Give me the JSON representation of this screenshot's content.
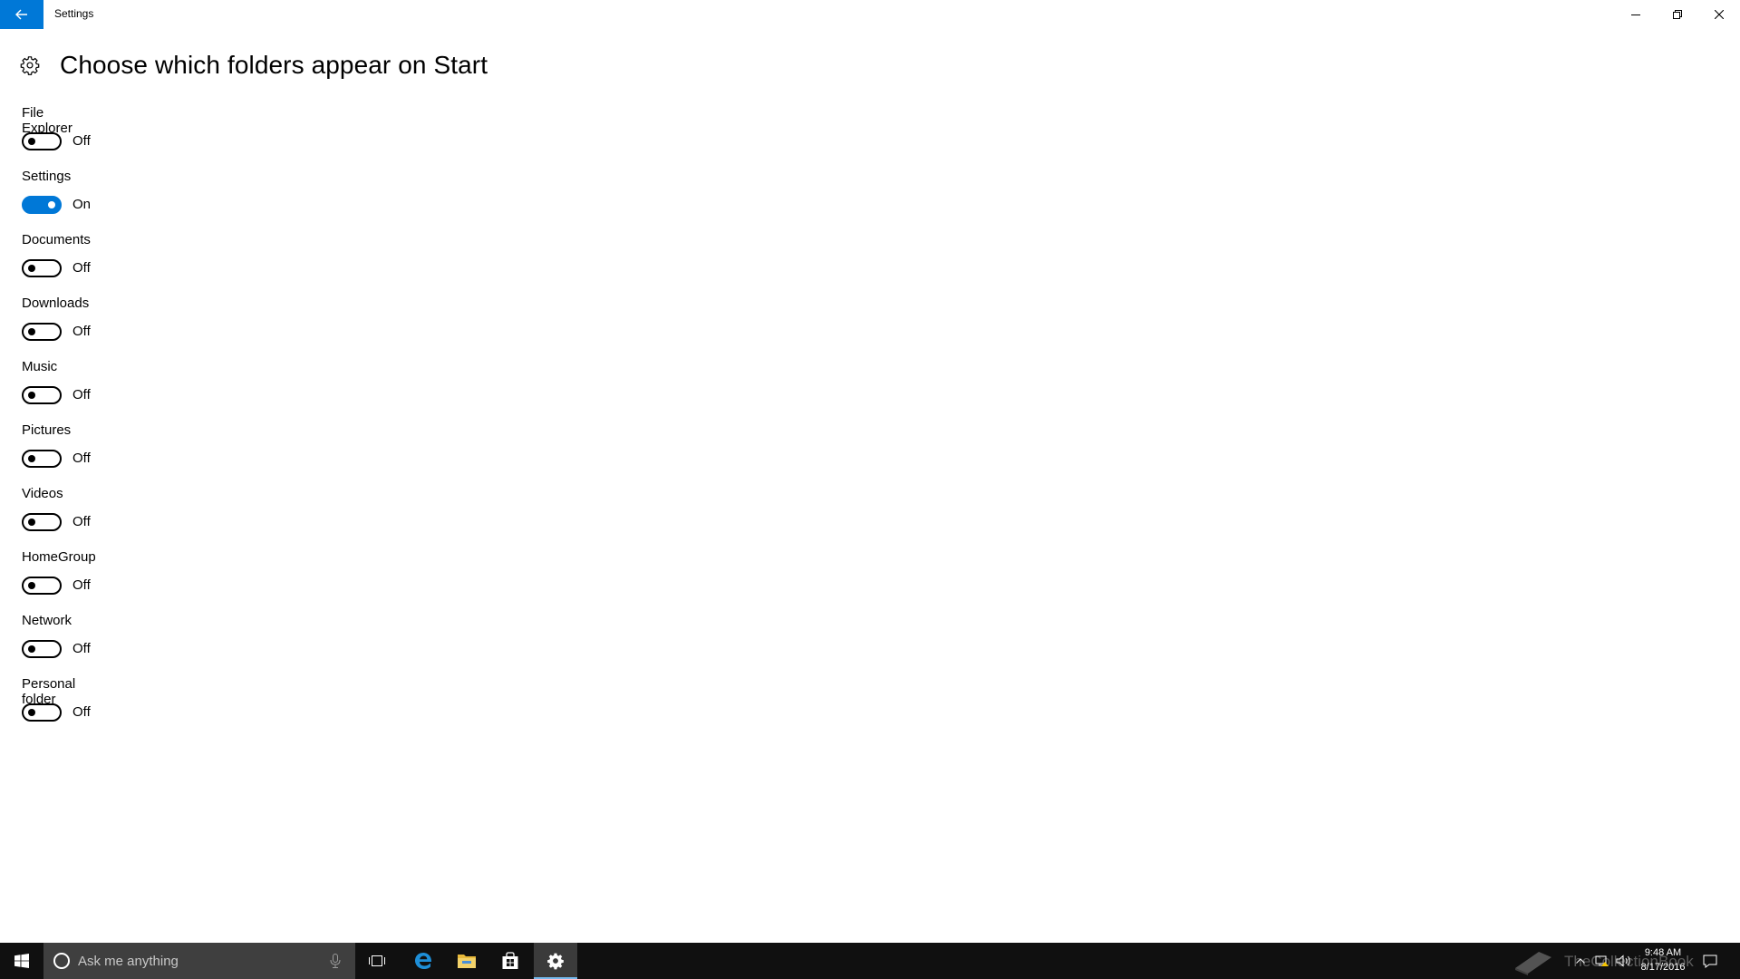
{
  "window": {
    "title": "Settings",
    "back_icon": "arrow-left-icon",
    "controls": [
      "minimize-icon",
      "restore-icon",
      "close-icon"
    ],
    "accent": "#0078d7"
  },
  "header": {
    "icon": "gear-icon",
    "title": "Choose which folders appear on Start"
  },
  "folders": [
    {
      "label": "File Explorer",
      "state": "Off",
      "on": false
    },
    {
      "label": "Settings",
      "state": "On",
      "on": true
    },
    {
      "label": "Documents",
      "state": "Off",
      "on": false
    },
    {
      "label": "Downloads",
      "state": "Off",
      "on": false
    },
    {
      "label": "Music",
      "state": "Off",
      "on": false
    },
    {
      "label": "Pictures",
      "state": "Off",
      "on": false
    },
    {
      "label": "Videos",
      "state": "Off",
      "on": false
    },
    {
      "label": "HomeGroup",
      "state": "Off",
      "on": false
    },
    {
      "label": "Network",
      "state": "Off",
      "on": false
    },
    {
      "label": "Personal folder",
      "state": "Off",
      "on": false
    }
  ],
  "taskbar": {
    "search_placeholder": "Ask me anything",
    "pinned": [
      "task-view-icon",
      "edge-icon",
      "file-explorer-icon",
      "store-icon",
      "settings-gear-icon"
    ],
    "tray_icons": [
      "chevron-up-icon",
      "network-icon",
      "volume-icon",
      "action-center-icon"
    ],
    "time": "9:48 AM",
    "date": "8/17/2016",
    "watermark": "TheCollectionBook"
  }
}
